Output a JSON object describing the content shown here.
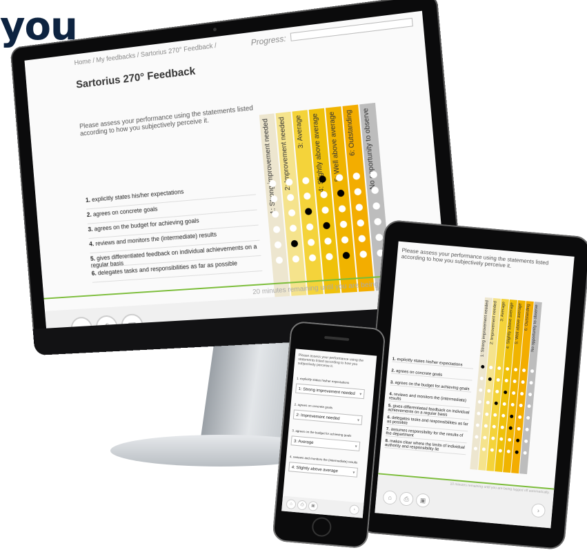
{
  "headline": "you",
  "desktop": {
    "breadcrumb": "Home / My feedbacks / Sartorius 270° Feedback /",
    "progress_label": "Progress:",
    "title": "Sartorius 270° Feedback",
    "intro": "Please assess your performance using the statements listed according to how you subjectively perceive it.",
    "timer_text": "20 minutes remaining until you are being logged",
    "columns": [
      {
        "label": "1: Strong improvement needed",
        "color": "#ede6cf"
      },
      {
        "label": "2: Improvement needed",
        "color": "#f5e38c"
      },
      {
        "label": "3: Average",
        "color": "#f4d33a"
      },
      {
        "label": "4: Slightly above average",
        "color": "#efc10a"
      },
      {
        "label": "5: Well above average",
        "color": "#f0b400"
      },
      {
        "label": "6: Outstanding",
        "color": "#f3ad00"
      },
      {
        "label": "No opportunity to observe",
        "color": "#bdbdbd"
      }
    ],
    "questions": [
      {
        "num": "1.",
        "text": "explicitly states his/her expectations",
        "selected": 3
      },
      {
        "num": "2.",
        "text": "agrees on concrete goals",
        "selected": 4
      },
      {
        "num": "3.",
        "text": "agrees on the budget for achieving goals",
        "selected": 2
      },
      {
        "num": "4.",
        "text": "reviews and monitors the (intermediate) results",
        "selected": 3
      },
      {
        "num": "5.",
        "text": "gives differentiated feedback on individual achievements on a regular basis",
        "selected": 1
      },
      {
        "num": "6.",
        "text": "delegates tasks and responsibilities as far as possible",
        "selected": 4
      }
    ],
    "footer_icons": [
      "home-icon",
      "print-icon",
      "save-icon"
    ]
  },
  "tablet": {
    "intro": "Please assess your performance using the statements listed according to how you subjectively perceive it.",
    "timer_text": "10 minutes remaining until you are being logged off automatically.",
    "columns": [
      {
        "label": "1: Strong improvement needed",
        "color": "#ede6cf"
      },
      {
        "label": "2: Improvement needed",
        "color": "#f5e38c"
      },
      {
        "label": "3: Average",
        "color": "#f4d33a"
      },
      {
        "label": "4: Slightly above average",
        "color": "#efc10a"
      },
      {
        "label": "5: Well above average",
        "color": "#f0b400"
      },
      {
        "label": "6: Outstanding",
        "color": "#f3ad00"
      },
      {
        "label": "No opportunity to observe",
        "color": "#bdbdbd"
      }
    ],
    "questions": [
      {
        "num": "1.",
        "text": "explicitly states his/her expectations",
        "selected": 0
      },
      {
        "num": "2.",
        "text": "agrees on concrete goals",
        "selected": 1
      },
      {
        "num": "3.",
        "text": "agrees on the budget for achieving goals",
        "selected": 3
      },
      {
        "num": "4.",
        "text": "reviews and monitors the (intermediate) results",
        "selected": 2
      },
      {
        "num": "5.",
        "text": "gives differentiated feedback on individual achievements on a regular basis",
        "selected": 4
      },
      {
        "num": "6.",
        "text": "delegates tasks and responsibilities as far as possible",
        "selected": 4
      },
      {
        "num": "7.",
        "text": "assumes responsibility for the results of the department",
        "selected": 5
      },
      {
        "num": "8.",
        "text": "makes clear where the limits of individual authority and responsibility lie",
        "selected": 5
      }
    ]
  },
  "phone": {
    "intro": "Please assess your performance using the statements listed according to how you subjectively perceive it.",
    "questions": [
      {
        "text": "1. explicitly states his/her expectations",
        "value": "1: Strong improvement needed"
      },
      {
        "text": "2. agrees on concrete goals",
        "value": "2: Improvement needed"
      },
      {
        "text": "3. agrees on the budget for achieving goals",
        "value": "3: Average"
      },
      {
        "text": "4. reviews and monitors the (intermediate) results",
        "value": "4: Slightly above average"
      }
    ]
  }
}
